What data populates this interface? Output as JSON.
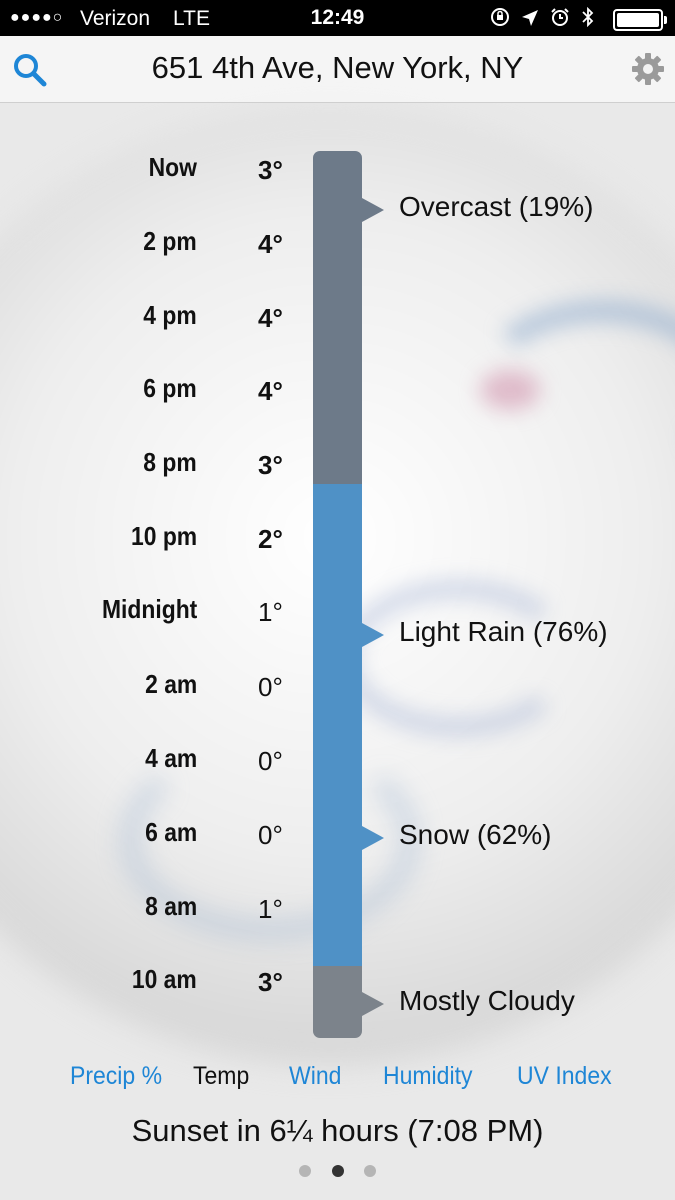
{
  "status_bar": {
    "signal": "●●●●○",
    "carrier": "Verizon",
    "network": "LTE",
    "time": "12:49",
    "battery_level": 1.0
  },
  "nav": {
    "title": "651 4th Ave, New York, NY",
    "search_icon": "search-icon",
    "settings_icon": "gear-icon"
  },
  "forecast": [
    {
      "time": "Now",
      "temp": "3°"
    },
    {
      "time": "2 pm",
      "temp": "4°"
    },
    {
      "time": "4 pm",
      "temp": "4°"
    },
    {
      "time": "6 pm",
      "temp": "4°"
    },
    {
      "time": "8 pm",
      "temp": "3°"
    },
    {
      "time": "10 pm",
      "temp": "2°"
    },
    {
      "time": "Midnight",
      "temp": "1°"
    },
    {
      "time": "2 am",
      "temp": "0°"
    },
    {
      "time": "4 am",
      "temp": "0°"
    },
    {
      "time": "6 am",
      "temp": "0°"
    },
    {
      "time": "8 am",
      "temp": "1°"
    },
    {
      "time": "10 am",
      "temp": "3°"
    }
  ],
  "conditions": [
    {
      "label": "Overcast (19%)"
    },
    {
      "label": "Light Rain (76%)"
    },
    {
      "label": "Snow (62%)"
    },
    {
      "label": "Mostly Cloudy"
    }
  ],
  "colors": {
    "overcast": "#6d7a89",
    "rain": "#4f91c6",
    "cloudy": "#7c838b",
    "tab_accent": "#1e86d6"
  },
  "tabs": [
    {
      "label": "Precip %",
      "active": false
    },
    {
      "label": "Temp",
      "active": true
    },
    {
      "label": "Wind",
      "active": false
    },
    {
      "label": "Humidity",
      "active": false
    },
    {
      "label": "UV Index",
      "active": false
    }
  ],
  "sunset": "Sunset in 6¼ hours (7:08 PM)",
  "page_indicator": {
    "count": 3,
    "current": 2
  }
}
